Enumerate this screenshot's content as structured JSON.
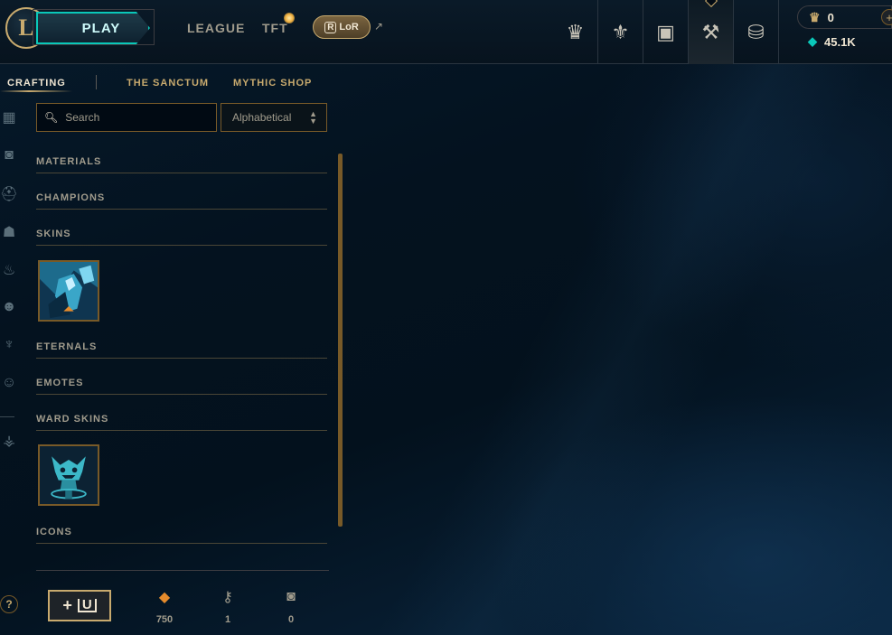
{
  "topbar": {
    "logo_letter": "L",
    "play_label": "PLAY",
    "nav": [
      {
        "label": "LEAGUE"
      },
      {
        "label": "TFT"
      }
    ],
    "lor_label": "LoR",
    "lor_mark": "R",
    "ext_glyph": "↗",
    "icons": [
      {
        "name": "worlds-trophy-icon",
        "glyph": "♛"
      },
      {
        "name": "profile-crest-icon",
        "glyph": "⚜"
      },
      {
        "name": "collection-icon",
        "glyph": "▣"
      },
      {
        "name": "loot-crafting-icon",
        "glyph": "⚒"
      },
      {
        "name": "store-coins-icon",
        "glyph": "⛁"
      }
    ],
    "active_icon": "loot-crafting-icon",
    "rp_value": "0",
    "rp_plus": "+",
    "blue_essence": "45.1K"
  },
  "subtabs": [
    {
      "label": "CRAFTING",
      "active": true
    },
    {
      "label": "THE SANCTUM",
      "active": false
    },
    {
      "label": "MYTHIC SHOP",
      "active": false
    }
  ],
  "rail": [
    {
      "name": "all-items-grid-icon",
      "glyph": "▦"
    },
    {
      "name": "chest-filter-icon",
      "glyph": "◙"
    },
    {
      "name": "champion-helmet-icon",
      "glyph": "⛑"
    },
    {
      "name": "skin-mask-icon",
      "glyph": "☗"
    },
    {
      "name": "flame-icon",
      "glyph": "♨"
    },
    {
      "name": "emote-face-icon",
      "glyph": "☻"
    },
    {
      "name": "ward-icon",
      "glyph": "♆"
    },
    {
      "name": "summoner-icon",
      "glyph": "☺"
    },
    {
      "name": "tft-icon",
      "glyph": "⚶"
    }
  ],
  "search": {
    "placeholder": "Search",
    "value": ""
  },
  "sort": {
    "value": "Alphabetical",
    "up": "▲",
    "down": "▼"
  },
  "categories": [
    {
      "label": "MATERIALS"
    },
    {
      "label": "CHAMPIONS"
    },
    {
      "label": "SKINS"
    },
    {
      "label": "ETERNALS"
    },
    {
      "label": "EMOTES"
    },
    {
      "label": "WARD SKINS"
    },
    {
      "label": "ICONS"
    }
  ],
  "bottom": {
    "help": "?",
    "add_label": "+",
    "chest_glyph": "U",
    "resources": [
      {
        "name": "orange-essence",
        "glyph": "◆",
        "count": "750"
      },
      {
        "name": "key",
        "glyph": "⚷",
        "count": "1"
      },
      {
        "name": "chest",
        "glyph": "◙",
        "count": "0"
      }
    ]
  }
}
